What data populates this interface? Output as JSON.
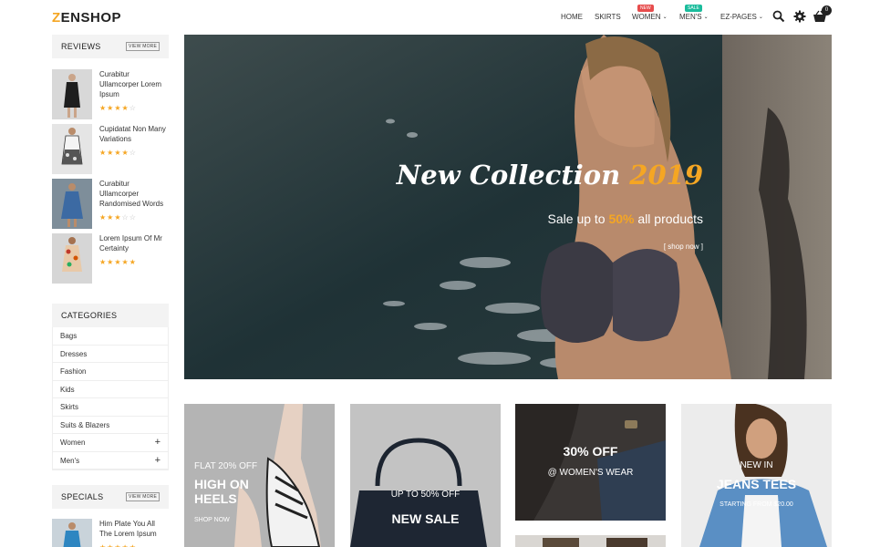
{
  "header": {
    "logo_first": "Z",
    "logo_rest": "ENSHOP",
    "nav": [
      {
        "label": "HOME"
      },
      {
        "label": "SKIRTS"
      },
      {
        "label": "WOMEN",
        "badge": "NEW"
      },
      {
        "label": "MEN'S",
        "badge": "SALE"
      },
      {
        "label": "EZ-PAGES"
      }
    ],
    "cart_count": "0",
    "icons": [
      "search-icon",
      "gear-icon",
      "cart-icon"
    ]
  },
  "reviews": {
    "title": "REVIEWS",
    "more": "VIEW MORE",
    "items": [
      {
        "name": "Curabitur Ullamcorper Lorem Ipsum",
        "rating": 4
      },
      {
        "name": "Cupidatat Non Many Variations",
        "rating": 4
      },
      {
        "name": "Curabitur Ullamcorper Randomised Words",
        "rating": 3
      },
      {
        "name": "Lorem Ipsum Of Mr Certainty",
        "rating": 5
      }
    ]
  },
  "categories": {
    "title": "CATEGORIES",
    "items": [
      "Bags",
      "Dresses",
      "Fashion",
      "Kids",
      "Skirts",
      "Suits & Blazers",
      "Women",
      "Men's"
    ]
  },
  "specials": {
    "title": "SPECIALS",
    "more": "VIEW MORE",
    "items": [
      {
        "name": "Him Plate You All The Lorem Ipsum"
      }
    ]
  },
  "hero": {
    "title_main": "New Collection ",
    "title_year": "2019",
    "sub_pre": "Sale up to ",
    "sub_pct": "50%",
    "sub_post": " all products",
    "link": "[ shop now ]"
  },
  "tiles": {
    "heels": {
      "line1": "FLAT 20% OFF",
      "line2": "HIGH ON",
      "line3": "HEELS",
      "cta": "SHOP NOW"
    },
    "sale": {
      "line1": "UP TO 50% OFF",
      "line2": "NEW SALE"
    },
    "womens": {
      "line1": "30% OFF",
      "line2": "@ WOMEN'S WEAR"
    },
    "jeans": {
      "line1": "NEW IN",
      "line2": "JEANS TEES",
      "line3": "STARTING FROM $20.00"
    }
  },
  "colors": {
    "accent": "#f5a623",
    "badge_new": "#e74c4c",
    "badge_sale": "#1abc9c"
  }
}
